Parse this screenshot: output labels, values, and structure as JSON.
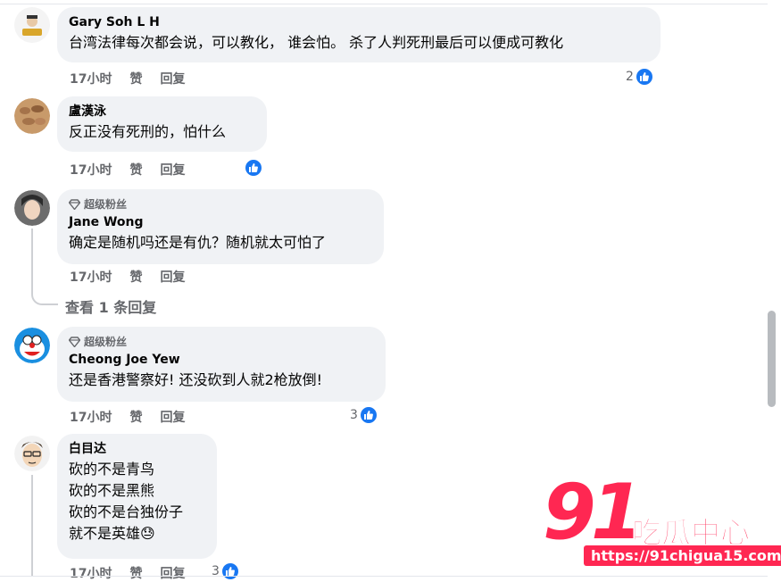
{
  "comments": [
    {
      "name": "Gary Soh L H",
      "text": "台湾法律每次都会说，可以教化， 谁会怕。 杀了人判死刑最后可以便成可教化",
      "time": "17小时",
      "like": "赞",
      "reply": "回复",
      "reaction_count": "2"
    },
    {
      "name": "盧漢泳",
      "text": "反正没有死刑的，怕什么",
      "time": "17小时",
      "like": "赞",
      "reply": "回复",
      "reaction_count": ""
    },
    {
      "badge": "超级粉丝",
      "name": "Jane Wong",
      "text": "确定是随机吗还是有仇？随机就太可怕了",
      "time": "17小时",
      "like": "赞",
      "reply": "回复",
      "view_replies": "查看 1 条回复"
    },
    {
      "badge": "超级粉丝",
      "name": "Cheong Joe Yew",
      "text": "还是香港警察好! 还没砍到人就2枪放倒!",
      "time": "17小时",
      "like": "赞",
      "reply": "回复",
      "reaction_count": "3"
    },
    {
      "name": "白目达",
      "lines": [
        "砍的不是青鸟",
        "砍的不是黑熊",
        "砍的不是台独份子",
        "就不是英雄"
      ],
      "emoji": "😓",
      "time": "17小时",
      "like": "赞",
      "reply": "回复",
      "reaction_count": "3"
    }
  ],
  "watermark": {
    "number": "91",
    "title": "吃瓜中心",
    "url": "https://91chigua15.com"
  },
  "colors": {
    "bubble": "#f0f2f5",
    "meta": "#65676b",
    "like_blue": "#1877f2",
    "watermark_red": "#ff2752"
  }
}
